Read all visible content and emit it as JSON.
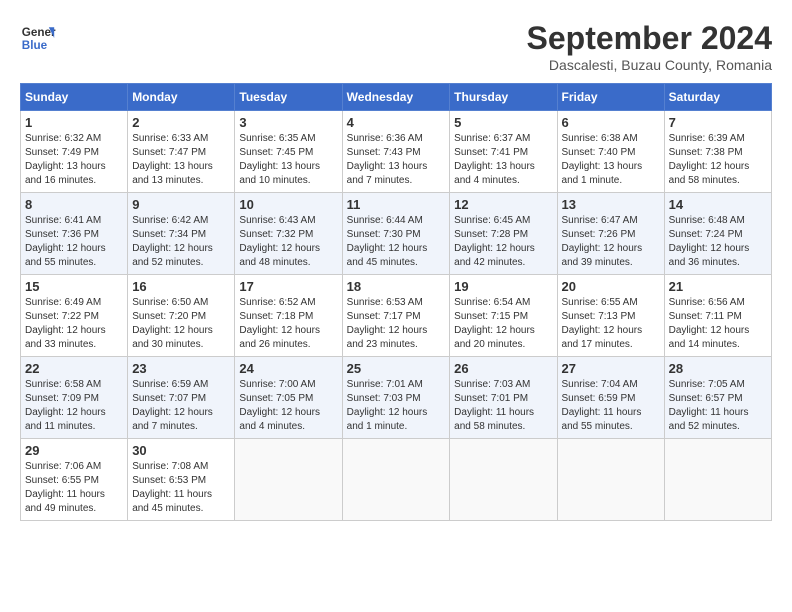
{
  "logo": {
    "line1": "General",
    "line2": "Blue"
  },
  "title": "September 2024",
  "subtitle": "Dascalesti, Buzau County, Romania",
  "weekdays": [
    "Sunday",
    "Monday",
    "Tuesday",
    "Wednesday",
    "Thursday",
    "Friday",
    "Saturday"
  ],
  "weeks": [
    [
      {
        "day": "1",
        "info": "Sunrise: 6:32 AM\nSunset: 7:49 PM\nDaylight: 13 hours\nand 16 minutes."
      },
      {
        "day": "2",
        "info": "Sunrise: 6:33 AM\nSunset: 7:47 PM\nDaylight: 13 hours\nand 13 minutes."
      },
      {
        "day": "3",
        "info": "Sunrise: 6:35 AM\nSunset: 7:45 PM\nDaylight: 13 hours\nand 10 minutes."
      },
      {
        "day": "4",
        "info": "Sunrise: 6:36 AM\nSunset: 7:43 PM\nDaylight: 13 hours\nand 7 minutes."
      },
      {
        "day": "5",
        "info": "Sunrise: 6:37 AM\nSunset: 7:41 PM\nDaylight: 13 hours\nand 4 minutes."
      },
      {
        "day": "6",
        "info": "Sunrise: 6:38 AM\nSunset: 7:40 PM\nDaylight: 13 hours\nand 1 minute."
      },
      {
        "day": "7",
        "info": "Sunrise: 6:39 AM\nSunset: 7:38 PM\nDaylight: 12 hours\nand 58 minutes."
      }
    ],
    [
      {
        "day": "8",
        "info": "Sunrise: 6:41 AM\nSunset: 7:36 PM\nDaylight: 12 hours\nand 55 minutes."
      },
      {
        "day": "9",
        "info": "Sunrise: 6:42 AM\nSunset: 7:34 PM\nDaylight: 12 hours\nand 52 minutes."
      },
      {
        "day": "10",
        "info": "Sunrise: 6:43 AM\nSunset: 7:32 PM\nDaylight: 12 hours\nand 48 minutes."
      },
      {
        "day": "11",
        "info": "Sunrise: 6:44 AM\nSunset: 7:30 PM\nDaylight: 12 hours\nand 45 minutes."
      },
      {
        "day": "12",
        "info": "Sunrise: 6:45 AM\nSunset: 7:28 PM\nDaylight: 12 hours\nand 42 minutes."
      },
      {
        "day": "13",
        "info": "Sunrise: 6:47 AM\nSunset: 7:26 PM\nDaylight: 12 hours\nand 39 minutes."
      },
      {
        "day": "14",
        "info": "Sunrise: 6:48 AM\nSunset: 7:24 PM\nDaylight: 12 hours\nand 36 minutes."
      }
    ],
    [
      {
        "day": "15",
        "info": "Sunrise: 6:49 AM\nSunset: 7:22 PM\nDaylight: 12 hours\nand 33 minutes."
      },
      {
        "day": "16",
        "info": "Sunrise: 6:50 AM\nSunset: 7:20 PM\nDaylight: 12 hours\nand 30 minutes."
      },
      {
        "day": "17",
        "info": "Sunrise: 6:52 AM\nSunset: 7:18 PM\nDaylight: 12 hours\nand 26 minutes."
      },
      {
        "day": "18",
        "info": "Sunrise: 6:53 AM\nSunset: 7:17 PM\nDaylight: 12 hours\nand 23 minutes."
      },
      {
        "day": "19",
        "info": "Sunrise: 6:54 AM\nSunset: 7:15 PM\nDaylight: 12 hours\nand 20 minutes."
      },
      {
        "day": "20",
        "info": "Sunrise: 6:55 AM\nSunset: 7:13 PM\nDaylight: 12 hours\nand 17 minutes."
      },
      {
        "day": "21",
        "info": "Sunrise: 6:56 AM\nSunset: 7:11 PM\nDaylight: 12 hours\nand 14 minutes."
      }
    ],
    [
      {
        "day": "22",
        "info": "Sunrise: 6:58 AM\nSunset: 7:09 PM\nDaylight: 12 hours\nand 11 minutes."
      },
      {
        "day": "23",
        "info": "Sunrise: 6:59 AM\nSunset: 7:07 PM\nDaylight: 12 hours\nand 7 minutes."
      },
      {
        "day": "24",
        "info": "Sunrise: 7:00 AM\nSunset: 7:05 PM\nDaylight: 12 hours\nand 4 minutes."
      },
      {
        "day": "25",
        "info": "Sunrise: 7:01 AM\nSunset: 7:03 PM\nDaylight: 12 hours\nand 1 minute."
      },
      {
        "day": "26",
        "info": "Sunrise: 7:03 AM\nSunset: 7:01 PM\nDaylight: 11 hours\nand 58 minutes."
      },
      {
        "day": "27",
        "info": "Sunrise: 7:04 AM\nSunset: 6:59 PM\nDaylight: 11 hours\nand 55 minutes."
      },
      {
        "day": "28",
        "info": "Sunrise: 7:05 AM\nSunset: 6:57 PM\nDaylight: 11 hours\nand 52 minutes."
      }
    ],
    [
      {
        "day": "29",
        "info": "Sunrise: 7:06 AM\nSunset: 6:55 PM\nDaylight: 11 hours\nand 49 minutes."
      },
      {
        "day": "30",
        "info": "Sunrise: 7:08 AM\nSunset: 6:53 PM\nDaylight: 11 hours\nand 45 minutes."
      },
      {
        "day": "",
        "info": ""
      },
      {
        "day": "",
        "info": ""
      },
      {
        "day": "",
        "info": ""
      },
      {
        "day": "",
        "info": ""
      },
      {
        "day": "",
        "info": ""
      }
    ]
  ]
}
